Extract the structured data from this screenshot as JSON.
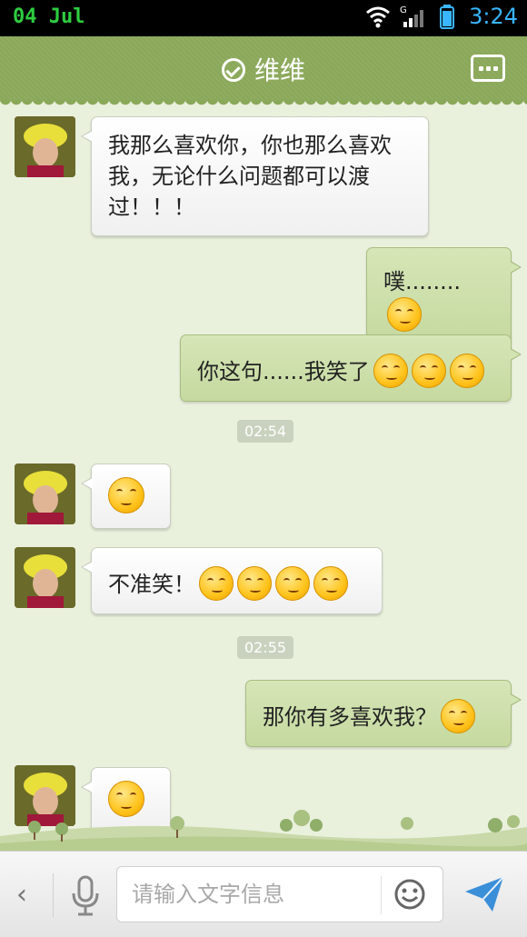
{
  "status_bar": {
    "date": "04  Jul",
    "time": "3:24",
    "icons": [
      "wifi-icon",
      "signal-icon",
      "battery-icon"
    ]
  },
  "header": {
    "title": "维维",
    "icons": [
      "verified-check-icon",
      "more-menu-icon"
    ]
  },
  "messages": [
    {
      "side": "in",
      "text": "我那么喜欢你，你也那么喜欢我，无论什么问题都可以渡过！！！",
      "emoji_count": 0,
      "emoji": ""
    },
    {
      "side": "out",
      "text": "噗........",
      "emoji_count": 1,
      "emoji": "chuckle-emoji"
    },
    {
      "side": "out",
      "text": "你这句......我笑了",
      "emoji_count": 3,
      "emoji": "chuckle-emoji"
    },
    {
      "side": "time",
      "text": "02:54"
    },
    {
      "side": "in",
      "text": "",
      "emoji_count": 1,
      "emoji": "dizzy-emoji"
    },
    {
      "side": "in",
      "text": "不准笑！",
      "emoji_count": 4,
      "emoji": "crying-laugh-emoji"
    },
    {
      "side": "time",
      "text": "02:55"
    },
    {
      "side": "out",
      "text": "那你有多喜欢我？",
      "emoji_count": 1,
      "emoji": "smug-emoji"
    },
    {
      "side": "in",
      "text": "",
      "emoji_count": 1,
      "emoji": "eye-roll-emoji"
    }
  ],
  "input_bar": {
    "placeholder": "请输入文字信息",
    "value": "",
    "icons": [
      "back-arrow-icon",
      "microphone-icon",
      "smiley-icon",
      "send-icon"
    ]
  },
  "colors": {
    "header": "#8aa859",
    "background": "#e9f0dc",
    "outgoing_bubble": "#cbdca8",
    "incoming_bubble": "#ffffff",
    "time_accent": "#39b6ff"
  }
}
